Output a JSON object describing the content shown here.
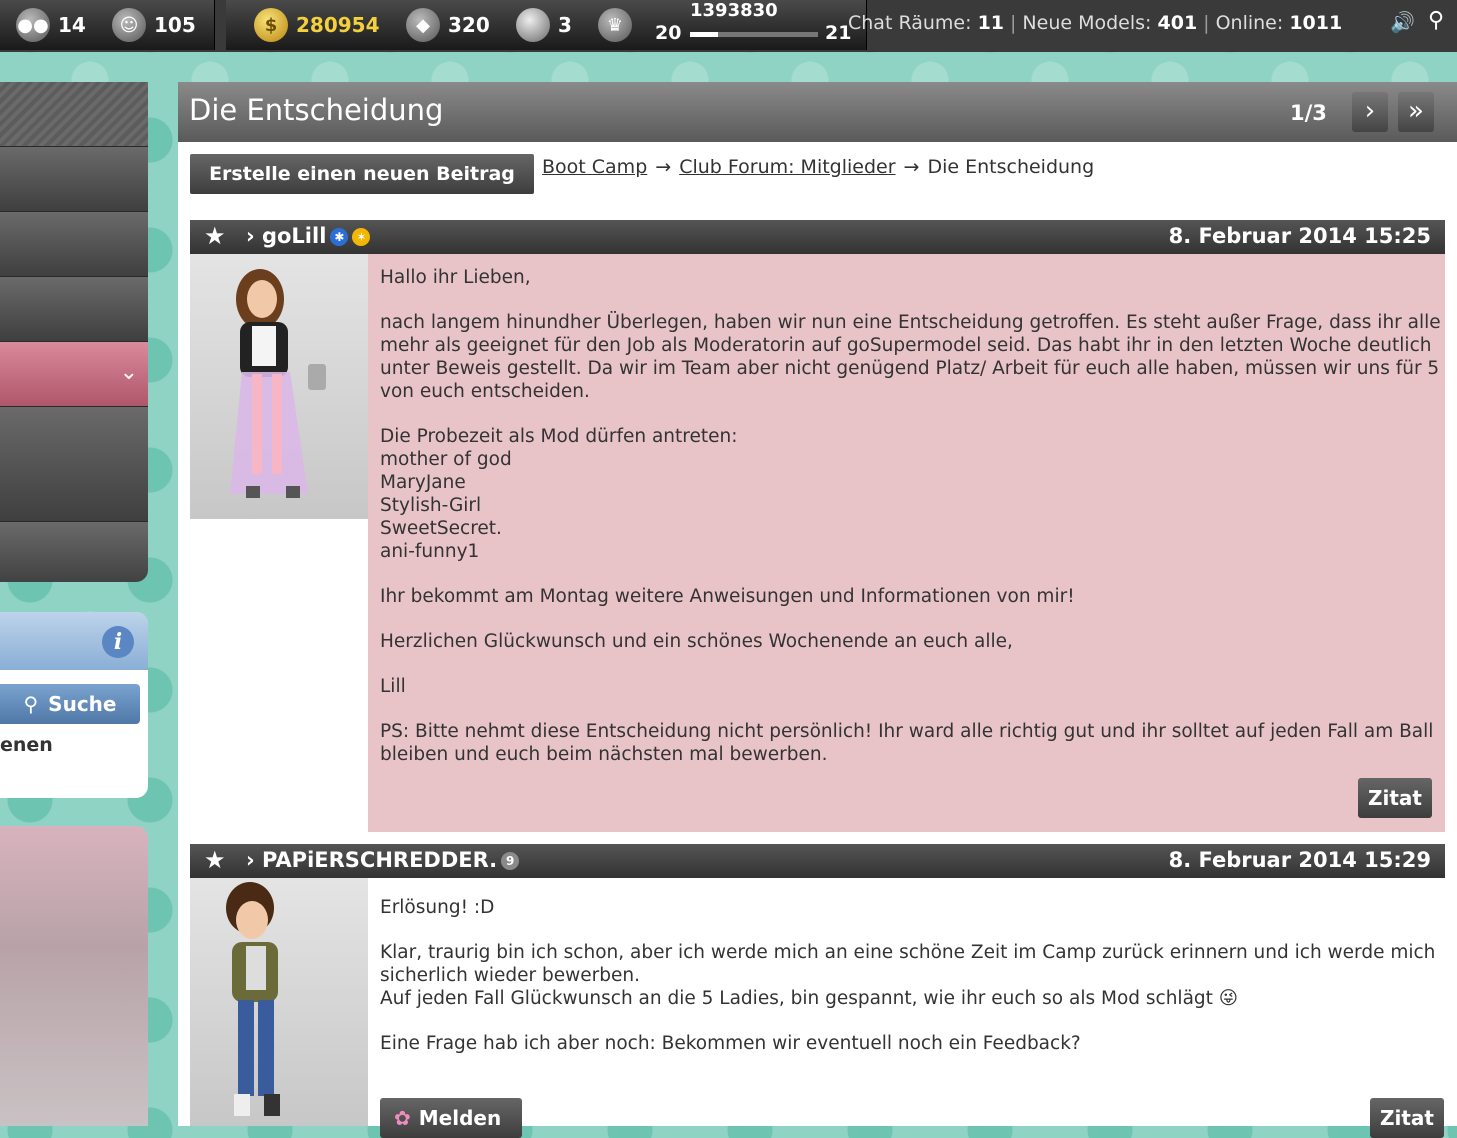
{
  "topbar": {
    "friends_count": "14",
    "smiley_count": "105",
    "coins": "280954",
    "diamonds": "320",
    "pearls": "3",
    "xp_total": "1393830",
    "level_current": "20",
    "level_next": "21",
    "xp_progress": 0.22,
    "stats": {
      "chat_label": "Chat Räume:",
      "chat_value": "11",
      "new_models_label": "Neue Models:",
      "new_models_value": "401",
      "online_label": "Online:",
      "online_value": "1011"
    }
  },
  "sidebar": {
    "search_label": "Suche",
    "info_text_fragment": "enen"
  },
  "page": {
    "title": "Die Entscheidung",
    "pager": "1/3",
    "next_symbol": "›",
    "last_symbol": "»",
    "new_post_label": "Erstelle einen neuen Beitrag",
    "breadcrumb": {
      "crumb1": "Boot Camp",
      "crumb2": "Club Forum: Mitglieder",
      "current": "Die Entscheidung",
      "arrow": "→"
    }
  },
  "posts": [
    {
      "username": "goLill",
      "date": "8. Februar 2014 15:25",
      "quote_label": "Zitat",
      "paragraphs": [
        "Hallo ihr Lieben,",
        "nach langem hinundher Überlegen, haben wir nun eine Entscheidung getroffen. Es steht außer Frage, dass ihr alle mehr als geeignet für den Job als Moderatorin auf goSupermodel seid. Das habt ihr in den letzten Woche deutlich unter Beweis gestellt. Da wir im Team aber nicht genügend Platz/ Arbeit für euch alle haben, müssen wir uns für 5 von euch entscheiden.",
        "Die Probezeit als Mod dürfen antreten:\nmother of god\nMaryJane\nStylish-Girl\nSweetSecret.\nani-funny1",
        "Ihr bekommt am Montag weitere Anweisungen und Informationen von mir!",
        "Herzlichen Glückwunsch und ein schönes Wochenende an euch alle,",
        "Lill",
        "PS: Bitte nehmt diese Entscheidung nicht persönlich! Ihr ward alle richtig gut und ihr solltet auf jeden Fall am Ball bleiben und euch beim nächsten mal bewerben."
      ]
    },
    {
      "username": "PAPiERSCHREDDER.",
      "badge_value": "9",
      "date": "8. Februar 2014 15:29",
      "quote_label": "Zitat",
      "report_label": "Melden",
      "paragraphs": [
        "Erlösung! :D",
        "Klar, traurig bin ich schon, aber ich werde mich an eine schöne Zeit im Camp zurück erinnern und ich werde mich sicherlich wieder bewerben.\nAuf jeden Fall Glückwunsch an die 5 Ladies, bin gespannt, wie ihr euch so als Mod schlägt 😜",
        "Eine Frage hab ich aber noch: Bekommen wir eventuell noch ein Feedback?"
      ]
    }
  ],
  "colors": {
    "post1_bg": "#e8c4c8",
    "post2_bg": "#ffffff"
  }
}
